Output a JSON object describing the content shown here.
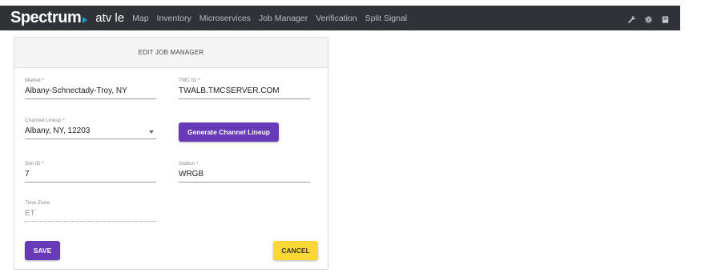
{
  "header": {
    "logo": "Spectrum",
    "app_name": "atv le",
    "nav": [
      "Map",
      "Inventory",
      "Microservices",
      "Job Manager",
      "Verification",
      "Split Signal"
    ],
    "icons": [
      "wrench-icon",
      "gear-icon",
      "book-icon"
    ]
  },
  "form": {
    "title": "EDIT JOB MANAGER",
    "market": {
      "label": "Market *",
      "value": "Albany-Schnectady-Troy, NY"
    },
    "tmc_id": {
      "label": "TMC ID *",
      "value": "TWALB.TMCSERVER.COM"
    },
    "channel_lineup": {
      "label": "Channel Lineup *",
      "value": "Albany, NY, 12203"
    },
    "generate_button": "Generate Channel Lineup",
    "slot_id": {
      "label": "Slot ID *",
      "value": "7"
    },
    "station": {
      "label": "Station *",
      "value": "WRGB"
    },
    "time_zone": {
      "label": "Time Zone",
      "value": "ET"
    },
    "save_button": "SAVE",
    "cancel_button": "CANCEL"
  },
  "colors": {
    "topbar": "#2f3338",
    "primary": "#673ab7",
    "accent": "#fdd835",
    "logo_arrow": "#1a9dd9"
  }
}
